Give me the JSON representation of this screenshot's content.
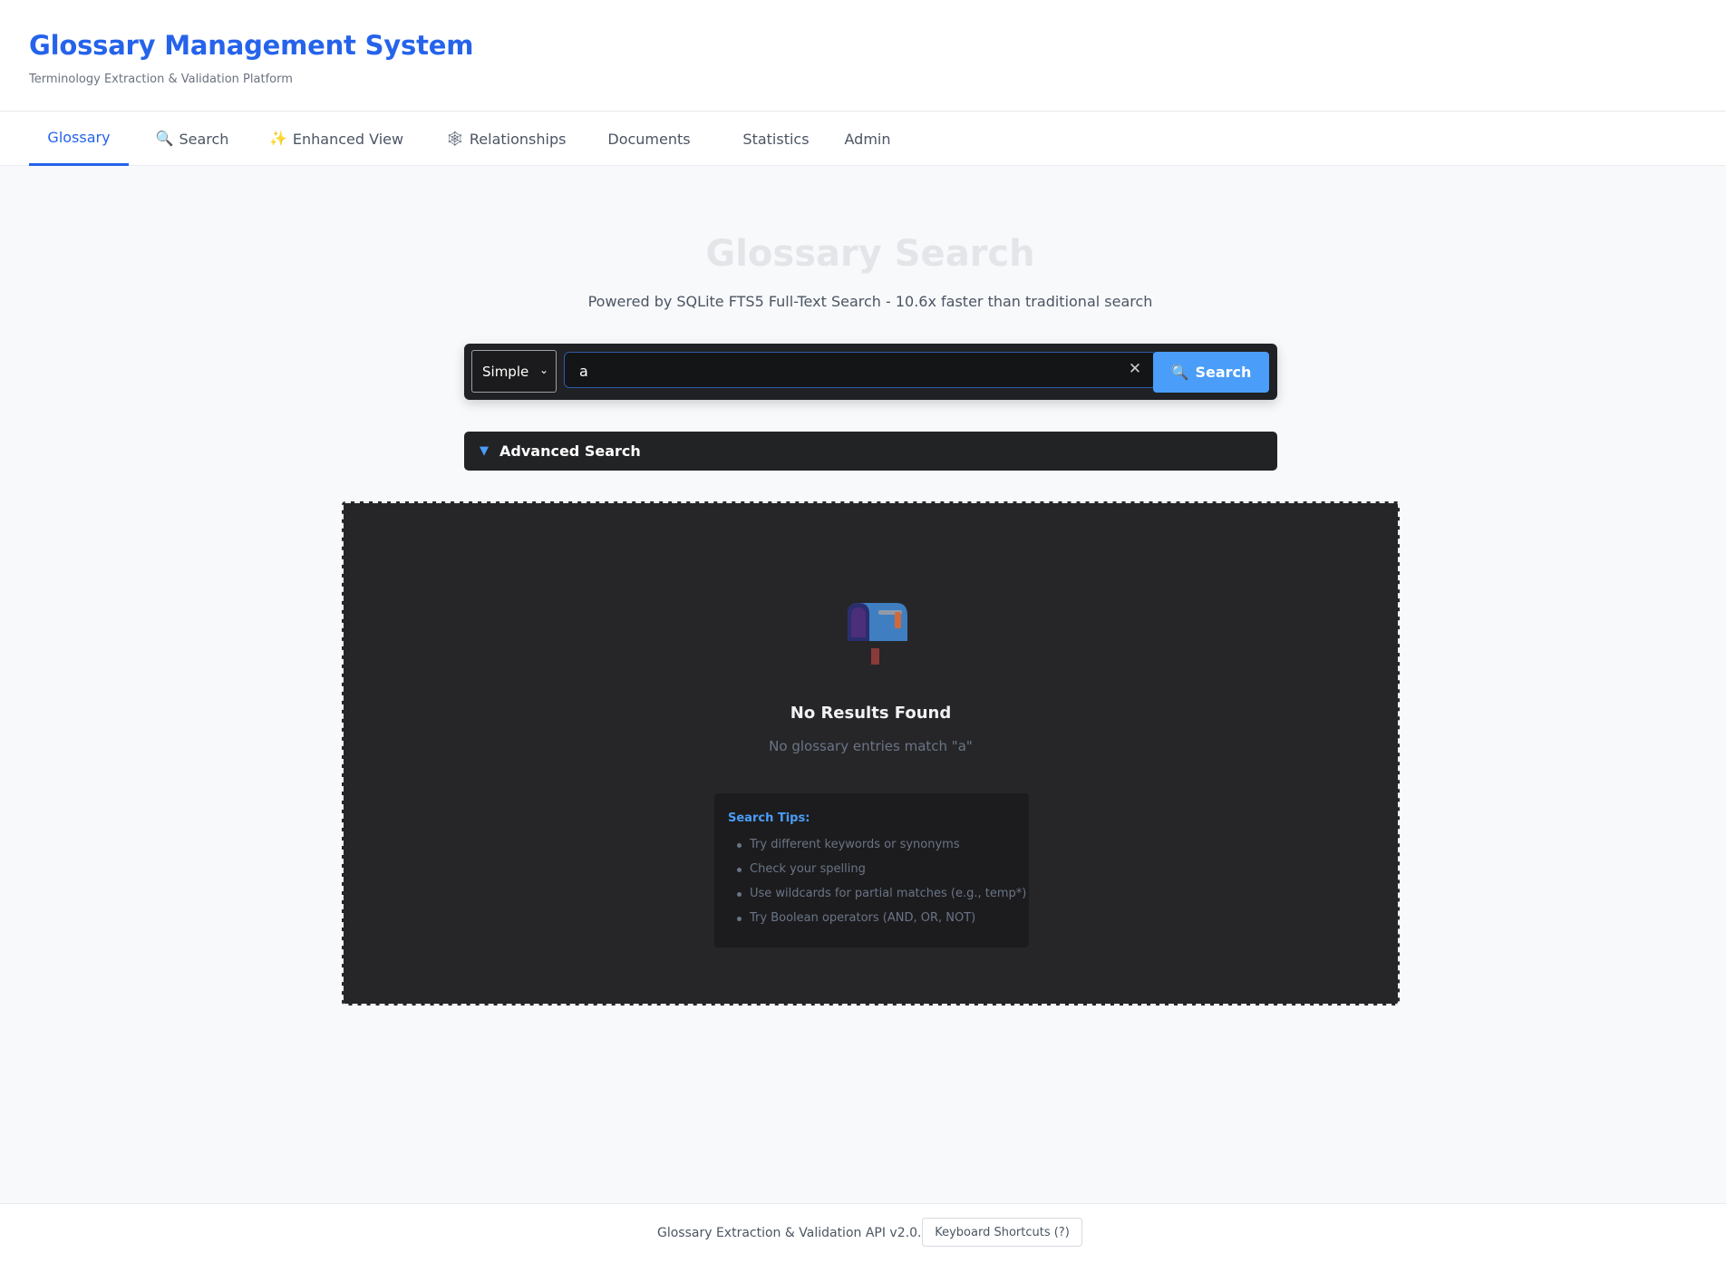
{
  "header": {
    "title": "Glossary Management System",
    "subtitle": "Terminology Extraction & Validation Platform"
  },
  "nav": {
    "tabs": [
      {
        "label": "Glossary",
        "icon": "",
        "active": true
      },
      {
        "label": "Search",
        "icon": "🔍",
        "active": false
      },
      {
        "label": "Enhanced View",
        "icon": "✨",
        "active": false
      },
      {
        "label": "Relationships",
        "icon": "🕸",
        "active": false
      },
      {
        "label": "Documents",
        "icon": "",
        "active": false
      },
      {
        "label": "Statistics",
        "icon": "",
        "active": false
      },
      {
        "label": "Admin",
        "icon": "",
        "active": false
      }
    ]
  },
  "hero": {
    "title": "Glossary Search",
    "subtitle": "Powered by SQLite FTS5 Full-Text Search - 10.6x faster than traditional search"
  },
  "search": {
    "mode": "Simple",
    "query": "a",
    "clear_symbol": "✕",
    "button_label": "Search",
    "button_icon": "🔍"
  },
  "advanced": {
    "arrow": "▼",
    "label": "Advanced Search"
  },
  "results": {
    "title": "No Results Found",
    "message": "No glossary entries match \"a\"",
    "tips_title": "Search Tips:",
    "tips": [
      "Try different keywords or synonyms",
      "Check your spelling",
      "Use wildcards for partial matches (e.g., temp*)",
      "Try Boolean operators (AND, OR, NOT)"
    ]
  },
  "footer": {
    "api_text": "Glossary Extraction & Validation API v2.0.0",
    "shortcuts_label": "Keyboard Shortcuts (?)"
  },
  "colors": {
    "brand": "#2563eb",
    "accent": "#4a9df8",
    "panel_dark": "#262628"
  }
}
